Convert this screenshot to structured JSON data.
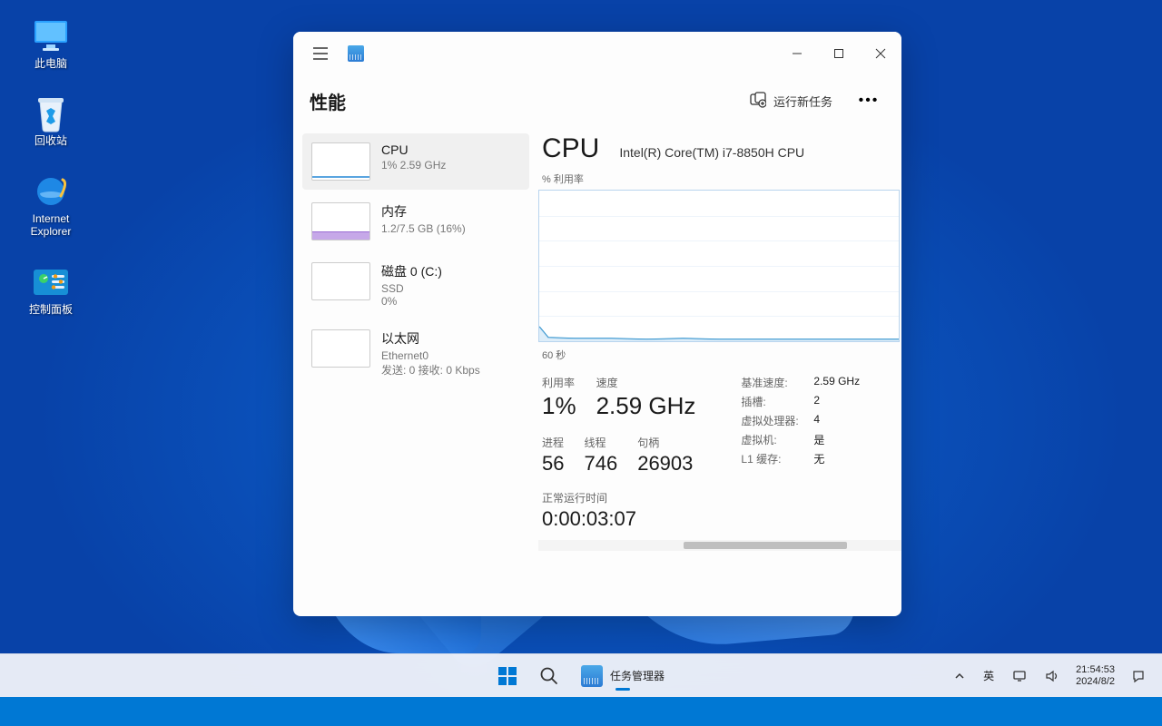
{
  "desktop": {
    "icons": [
      {
        "name": "this-pc",
        "label": "此电脑"
      },
      {
        "name": "recycle-bin",
        "label": "回收站"
      },
      {
        "name": "internet-explorer",
        "label": "Internet Explorer"
      },
      {
        "name": "control-panel",
        "label": "控制面板"
      }
    ]
  },
  "window": {
    "page_title": "性能",
    "run_new_task": "运行新任务",
    "sidebar": [
      {
        "id": "cpu",
        "label": "CPU",
        "sub": "1%  2.59 GHz",
        "active": true
      },
      {
        "id": "memory",
        "label": "内存",
        "sub": "1.2/7.5 GB (16%)"
      },
      {
        "id": "disk",
        "label": "磁盘 0 (C:)",
        "sub": "SSD",
        "sub2": "0%"
      },
      {
        "id": "ethernet",
        "label": "以太网",
        "sub": "Ethernet0",
        "sub2": "发送: 0 接收: 0 Kbps"
      }
    ],
    "detail": {
      "title": "CPU",
      "model": "Intel(R) Core(TM) i7-8850H CPU",
      "chart_top_label": "% 利用率",
      "chart_bottom_label": "60 秒",
      "stats": {
        "util_k": "利用率",
        "util_v": "1%",
        "speed_k": "速度",
        "speed_v": "2.59 GHz",
        "proc_k": "进程",
        "proc_v": "56",
        "thr_k": "线程",
        "thr_v": "746",
        "hnd_k": "句柄",
        "hnd_v": "26903",
        "uptime_k": "正常运行时间",
        "uptime_v": "0:00:03:07"
      },
      "right": [
        {
          "k": "基准速度:",
          "v": "2.59 GHz"
        },
        {
          "k": "插槽:",
          "v": "2"
        },
        {
          "k": "虚拟处理器:",
          "v": "4"
        },
        {
          "k": "虚拟机:",
          "v": "是"
        },
        {
          "k": "L1 缓存:",
          "v": "无"
        }
      ]
    }
  },
  "taskbar": {
    "app_name": "任务管理器",
    "ime": "英",
    "time": "21:54:53",
    "date": "2024/8/2"
  },
  "chart_data": {
    "type": "line",
    "title": "% 利用率",
    "xlabel": "60 秒",
    "ylabel": "% 利用率",
    "ylim": [
      0,
      100
    ],
    "x_seconds_ago": [
      60,
      55,
      50,
      45,
      40,
      35,
      30,
      25,
      20,
      15,
      10,
      5,
      0
    ],
    "values": [
      8,
      2,
      2,
      2,
      1,
      2,
      1,
      1,
      1,
      1,
      1,
      1,
      1
    ]
  }
}
